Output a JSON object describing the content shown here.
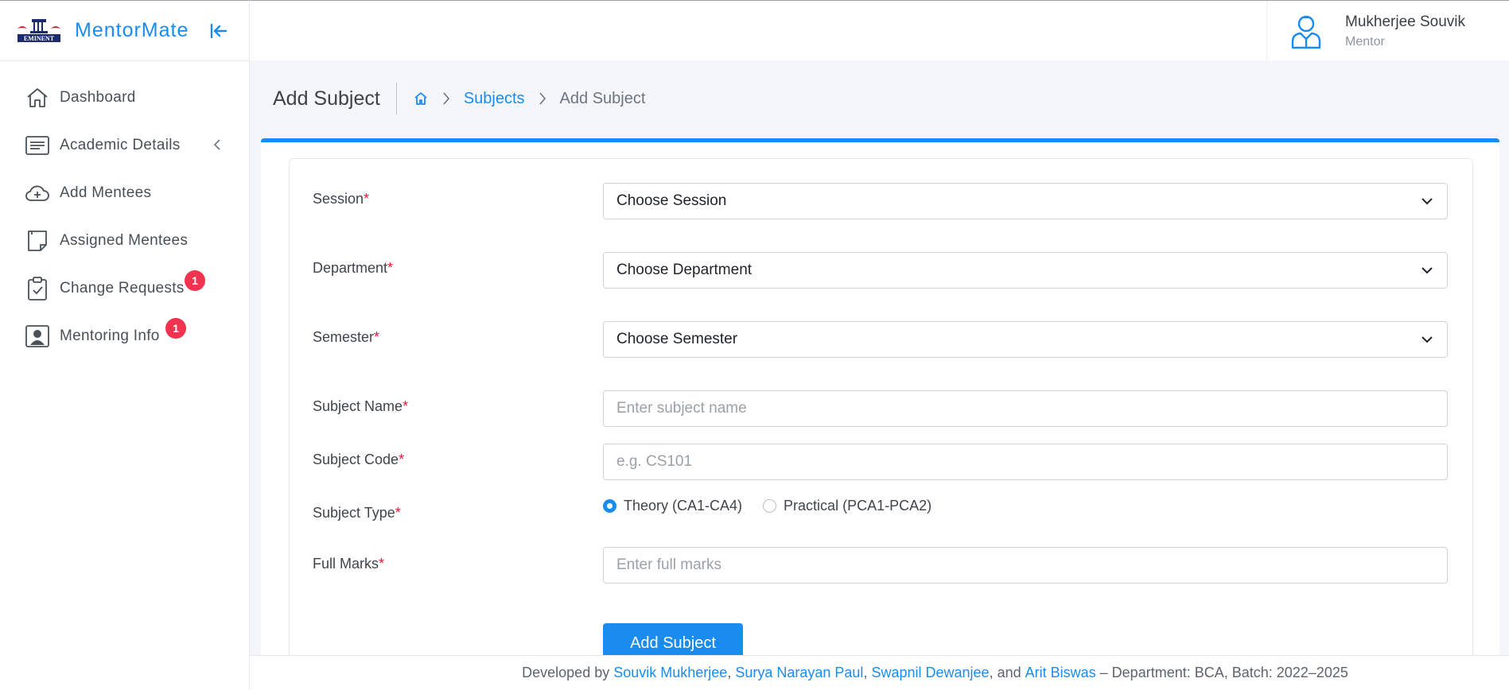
{
  "brand": {
    "name": "MentorMate",
    "logo_text": "EMINENT"
  },
  "sidebar": {
    "items": [
      {
        "label": "Dashboard",
        "icon": "home-icon"
      },
      {
        "label": "Academic Details",
        "icon": "list-icon",
        "has_submenu": true
      },
      {
        "label": "Add Mentees",
        "icon": "cloud-upload-icon"
      },
      {
        "label": "Assigned Mentees",
        "icon": "note-icon"
      },
      {
        "label": "Change Requests",
        "icon": "clipboard-check-icon",
        "badge": "1"
      },
      {
        "label": "Mentoring Info",
        "icon": "user-card-icon",
        "badge": "1"
      }
    ]
  },
  "user": {
    "name": "Mukherjee Souvik",
    "role": "Mentor"
  },
  "page": {
    "title": "Add Subject",
    "breadcrumb": {
      "link": "Subjects",
      "current": "Add Subject"
    }
  },
  "form": {
    "session": {
      "label": "Session",
      "value": "Choose Session"
    },
    "department": {
      "label": "Department",
      "value": "Choose Department"
    },
    "semester": {
      "label": "Semester",
      "value": "Choose Semester"
    },
    "subject_name": {
      "label": "Subject Name",
      "placeholder": "Enter subject name"
    },
    "subject_code": {
      "label": "Subject Code",
      "placeholder": "e.g. CS101"
    },
    "subject_type": {
      "label": "Subject Type",
      "options": [
        "Theory (CA1-CA4)",
        "Practical (PCA1-PCA2)"
      ],
      "selected": "Theory (CA1-CA4)"
    },
    "full_marks": {
      "label": "Full Marks",
      "placeholder": "Enter full marks"
    },
    "required_mark": "*",
    "submit_label": "Add Subject"
  },
  "footer": {
    "prefix": "Developed by",
    "devs": [
      "Souvik Mukherjee",
      "Surya Narayan Paul",
      "Swapnil Dewanjee",
      "Arit Biswas"
    ],
    "sep": ",",
    "and": ", and",
    "suffix": "– Department: BCA, Batch: 2022–2025"
  },
  "colors": {
    "accent": "#1a8cf0",
    "badge": "#f1334f",
    "required": "#e2173a"
  }
}
